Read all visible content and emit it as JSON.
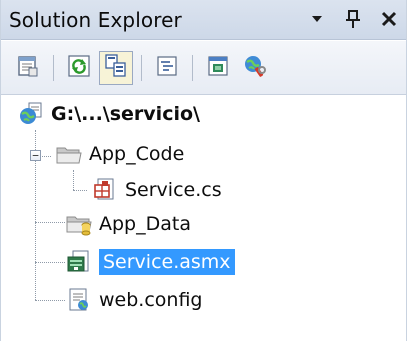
{
  "window": {
    "title": "Solution Explorer",
    "controls": {
      "dropdown_icon": "dropdown-arrow-icon",
      "pin_icon": "pin-icon",
      "close_icon": "close-icon"
    }
  },
  "toolbar": {
    "buttons": [
      {
        "icon": "properties-icon"
      },
      {
        "icon": "refresh-icon"
      },
      {
        "icon": "nest-related-files-icon",
        "active": true
      },
      {
        "icon": "view-code-icon"
      },
      {
        "icon": "view-designer-icon"
      },
      {
        "icon": "asp-net-configuration-icon"
      }
    ]
  },
  "tree": {
    "root": {
      "label": "G:\\...\\servicio\\",
      "icon": "web-project-icon"
    },
    "items": [
      {
        "label": "App_Code",
        "icon": "folder-icon",
        "expanded": true
      },
      {
        "label": "Service.cs",
        "icon": "cs-file-icon"
      },
      {
        "label": "App_Data",
        "icon": "folder-data-icon"
      },
      {
        "label": "Service.asmx",
        "icon": "asmx-file-icon",
        "selected": true
      },
      {
        "label": "web.config",
        "icon": "config-file-icon"
      }
    ]
  },
  "colors": {
    "selection": "#3399ff",
    "titlebar": "#cdd8e8",
    "toolbar": "#e7ecf4"
  }
}
